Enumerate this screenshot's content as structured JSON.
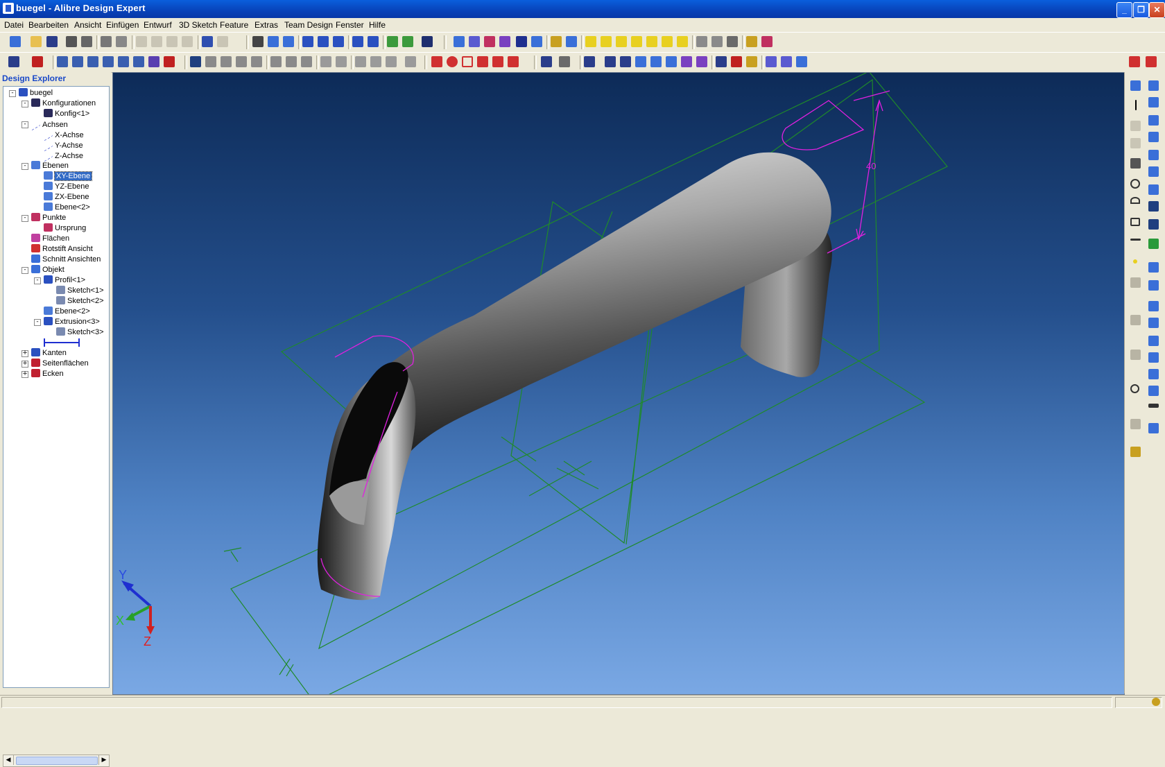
{
  "window": {
    "title": "buegel - Alibre Design Expert",
    "controls": {
      "minimize": "_",
      "restore": "❐",
      "close": "✕"
    }
  },
  "menu": [
    "Datei",
    "Bearbeiten",
    "Ansicht",
    "Einfügen",
    "Entwurf",
    "3D Sketch",
    "Feature",
    "Extras",
    "Team Design",
    "Fenster",
    "Hilfe"
  ],
  "explorer": {
    "title": "Design Explorer",
    "tree": [
      {
        "label": "buegel",
        "depth": 0,
        "expander": "-",
        "icon": "part-icon"
      },
      {
        "label": "Konfigurationen",
        "depth": 1,
        "expander": "-",
        "icon": "table-icon"
      },
      {
        "label": "Konfig<1>",
        "depth": 2,
        "expander": "",
        "icon": "table-icon"
      },
      {
        "label": "Achsen",
        "depth": 1,
        "expander": "-",
        "icon": "axis-icon"
      },
      {
        "label": "X-Achse",
        "depth": 2,
        "expander": "",
        "icon": "axis-icon"
      },
      {
        "label": "Y-Achse",
        "depth": 2,
        "expander": "",
        "icon": "axis-icon"
      },
      {
        "label": "Z-Achse",
        "depth": 2,
        "expander": "",
        "icon": "axis-icon"
      },
      {
        "label": "Ebenen",
        "depth": 1,
        "expander": "-",
        "icon": "plane-icon"
      },
      {
        "label": "XY-Ebene",
        "depth": 2,
        "expander": "",
        "icon": "plane-icon",
        "selected": true
      },
      {
        "label": "YZ-Ebene",
        "depth": 2,
        "expander": "",
        "icon": "plane-icon"
      },
      {
        "label": "ZX-Ebene",
        "depth": 2,
        "expander": "",
        "icon": "plane-icon"
      },
      {
        "label": "Ebene<2>",
        "depth": 2,
        "expander": "",
        "icon": "plane-icon"
      },
      {
        "label": "Punkte",
        "depth": 1,
        "expander": "-",
        "icon": "point-icon"
      },
      {
        "label": "Ursprung",
        "depth": 2,
        "expander": "",
        "icon": "point-icon"
      },
      {
        "label": "Flächen",
        "depth": 1,
        "expander": "",
        "icon": "surface-icon"
      },
      {
        "label": "Rotstift Ansicht",
        "depth": 1,
        "expander": "",
        "icon": "redline-icon"
      },
      {
        "label": "Schnitt Ansichten",
        "depth": 1,
        "expander": "",
        "icon": "section-icon"
      },
      {
        "label": "Objekt",
        "depth": 1,
        "expander": "-",
        "icon": "object-icon"
      },
      {
        "label": "Profil<1>",
        "depth": 2,
        "expander": "-",
        "icon": "sweep-icon"
      },
      {
        "label": "Sketch<1>",
        "depth": 3,
        "expander": "",
        "icon": "sketch-icon"
      },
      {
        "label": "Sketch<2>",
        "depth": 3,
        "expander": "",
        "icon": "sketch-icon"
      },
      {
        "label": "Ebene<2>",
        "depth": 2,
        "expander": "",
        "icon": "plane-icon"
      },
      {
        "label": "Extrusion<3>",
        "depth": 2,
        "expander": "-",
        "icon": "extrude-icon"
      },
      {
        "label": "Sketch<3>",
        "depth": 3,
        "expander": "",
        "icon": "sketch-icon"
      },
      {
        "label": "",
        "depth": 2,
        "expander": "",
        "icon": "end-of-part-marker"
      },
      {
        "label": "Kanten",
        "depth": 1,
        "expander": "+",
        "icon": "edges-icon"
      },
      {
        "label": "Seitenflächen",
        "depth": 1,
        "expander": "+",
        "icon": "faces-icon"
      },
      {
        "label": "Ecken",
        "depth": 1,
        "expander": "+",
        "icon": "vertices-icon"
      }
    ]
  },
  "viewport": {
    "dimension_label": "40",
    "triad": {
      "x": "X",
      "y": "Y",
      "z": "Z"
    }
  },
  "colors": {
    "sketch_magenta": "#e020e0",
    "plane_green": "#1f8a2a",
    "selection_blue": "#316ac5"
  }
}
